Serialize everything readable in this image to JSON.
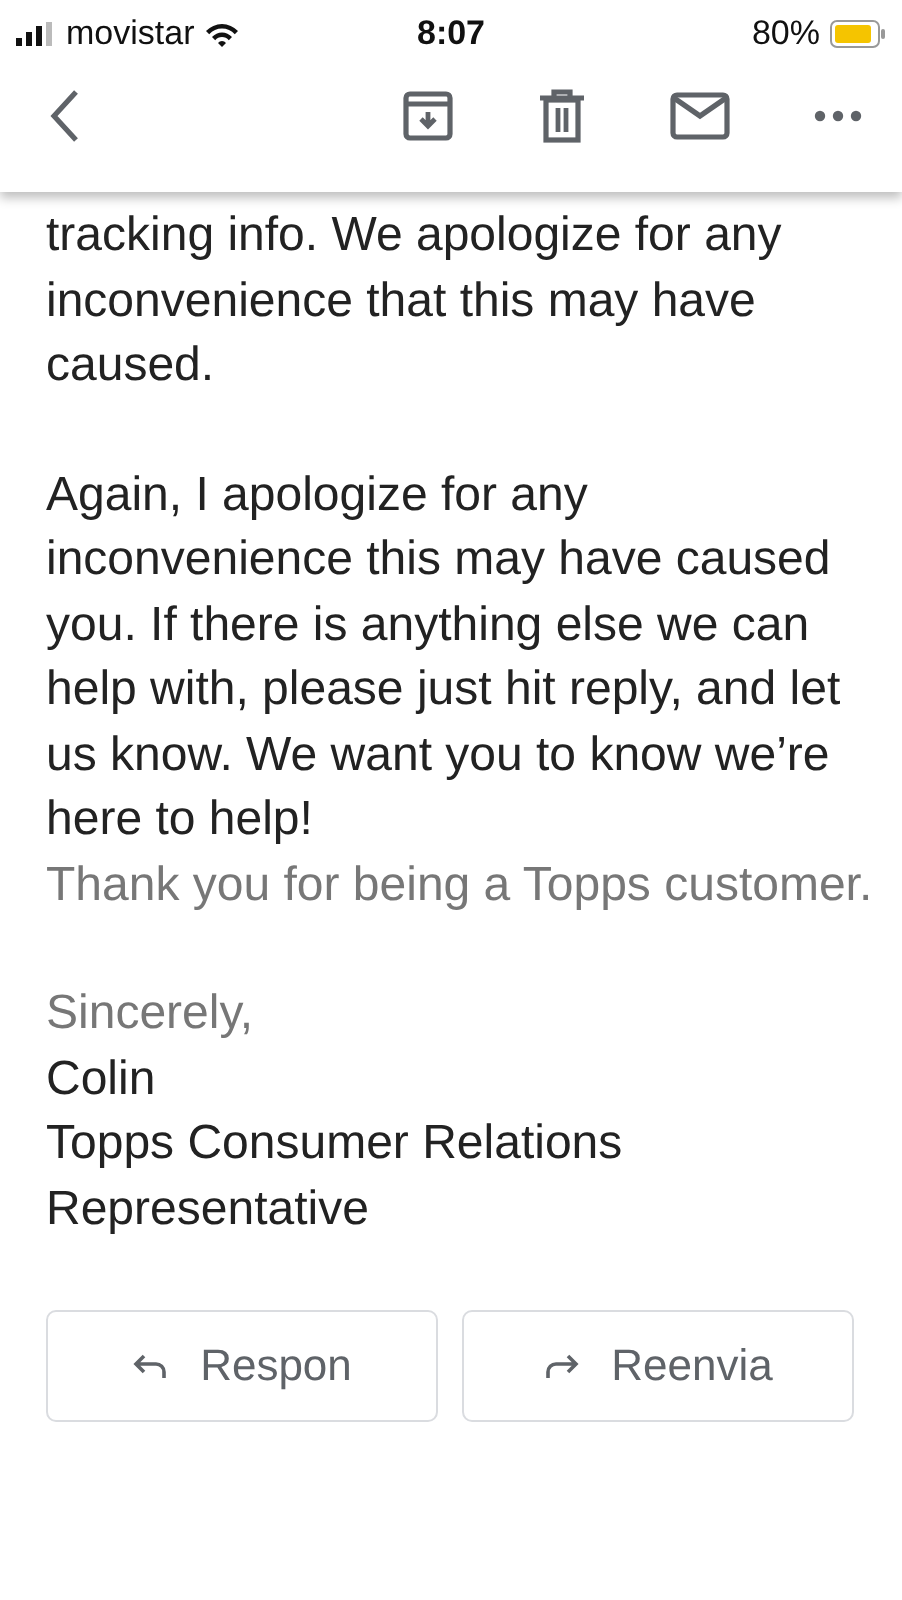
{
  "status_bar": {
    "carrier": "movistar",
    "time": "8:07",
    "battery": "80%"
  },
  "message": {
    "paragraphs": [
      {
        "text": "tracking info. We apologize for any inconvenience that this may have caused.",
        "muted": false
      },
      {
        "text": "Again, I apologize for any inconvenience this may have caused you. If there is anything else we can help with, please just hit reply, and let us know. We want you to know we’re here to help!",
        "muted": false
      },
      {
        "text": "Thank you for being a Topps customer.",
        "muted": true
      }
    ],
    "signature": [
      {
        "text": "Sincerely,",
        "muted": true
      },
      {
        "text": "Colin",
        "muted": false
      },
      {
        "text": "Topps Consumer Relations Representative",
        "muted": false
      }
    ]
  },
  "actions": [
    {
      "label": "Respon",
      "kind": "reply"
    },
    {
      "label": "Reenvia",
      "kind": "forward"
    }
  ]
}
